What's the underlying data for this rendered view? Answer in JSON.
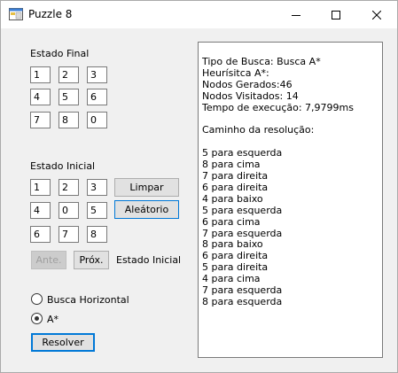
{
  "window": {
    "title": "Puzzle 8"
  },
  "estado_final": {
    "label": "Estado Final",
    "cells": [
      "1",
      "2",
      "3",
      "4",
      "5",
      "6",
      "7",
      "8",
      "0"
    ]
  },
  "estado_inicial": {
    "label": "Estado Inicial",
    "cells": [
      "1",
      "2",
      "3",
      "4",
      "0",
      "5",
      "6",
      "7",
      "8"
    ]
  },
  "buttons": {
    "limpar": "Limpar",
    "aleatorio": "Aleátorio",
    "anterior": "Ante.",
    "proximo": "Próx.",
    "resolver": "Resolver"
  },
  "step_status": "Estado Inicial",
  "search": {
    "options": [
      {
        "label": "Busca Horizontal",
        "selected": false
      },
      {
        "label": "A*",
        "selected": true
      }
    ]
  },
  "output": {
    "lines": [
      "Tipo de Busca: Busca A*",
      "Heurísitca A*:",
      "Nodos Gerados:46",
      "Nodos Visitados: 14",
      "Tempo de execução: 7,9799ms",
      "",
      "Caminho da resolução:",
      "",
      "5 para esquerda",
      "8 para cima",
      "7 para direita",
      "6 para direita",
      "4 para baixo",
      "5 para esquerda",
      "6 para cima",
      "7 para esquerda",
      "8 para baixo",
      "6 para direita",
      "5 para direita",
      "4 para cima",
      "7 para esquerda",
      "8 para esquerda"
    ]
  }
}
